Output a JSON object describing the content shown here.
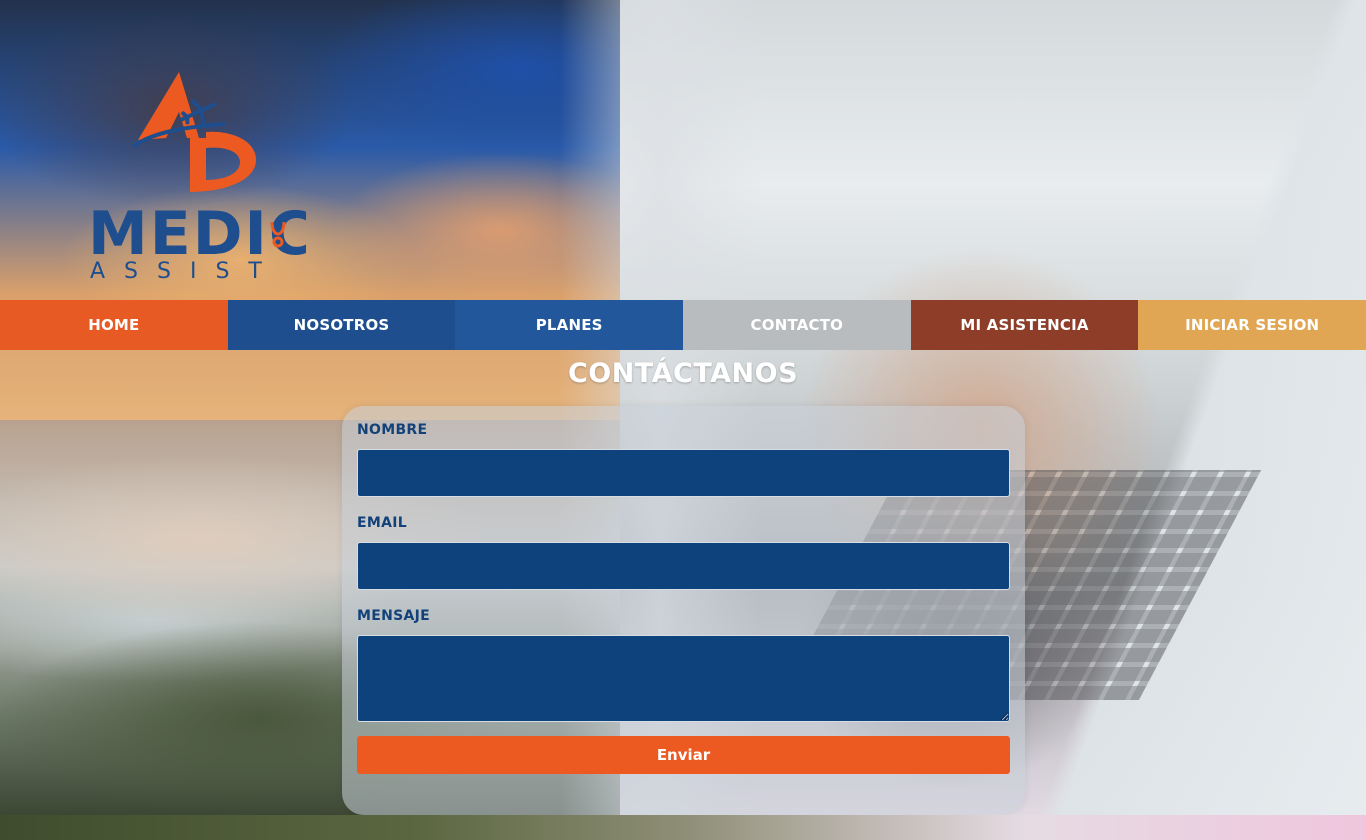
{
  "logo": {
    "mark": "AD",
    "word1": "MEDIC",
    "word2": "ASSIST",
    "icons": [
      "airplane-icon",
      "stethoscope-icon"
    ]
  },
  "nav": {
    "items": [
      {
        "label": "HOME",
        "color": "#e85a24"
      },
      {
        "label": "NOSOTROS",
        "color": "#1e4e8d"
      },
      {
        "label": "PLANES",
        "color": "#22579b"
      },
      {
        "label": "CONTACTO",
        "color": "#b9bcbf"
      },
      {
        "label": "MI ASISTENCIA",
        "color": "#8d3d28"
      },
      {
        "label": "INICIAR SESION",
        "color": "#e1a654"
      }
    ]
  },
  "contact": {
    "title": "CONTÁCTANOS",
    "fields": {
      "name_label": "NOMBRE",
      "email_label": "EMAIL",
      "message_label": "MENSAJE",
      "name_value": "",
      "email_value": "",
      "message_value": ""
    },
    "submit_label": "Enviar"
  },
  "colors": {
    "brand_orange": "#ec5a22",
    "brand_blue": "#0e427d",
    "label_blue": "#13427a"
  }
}
